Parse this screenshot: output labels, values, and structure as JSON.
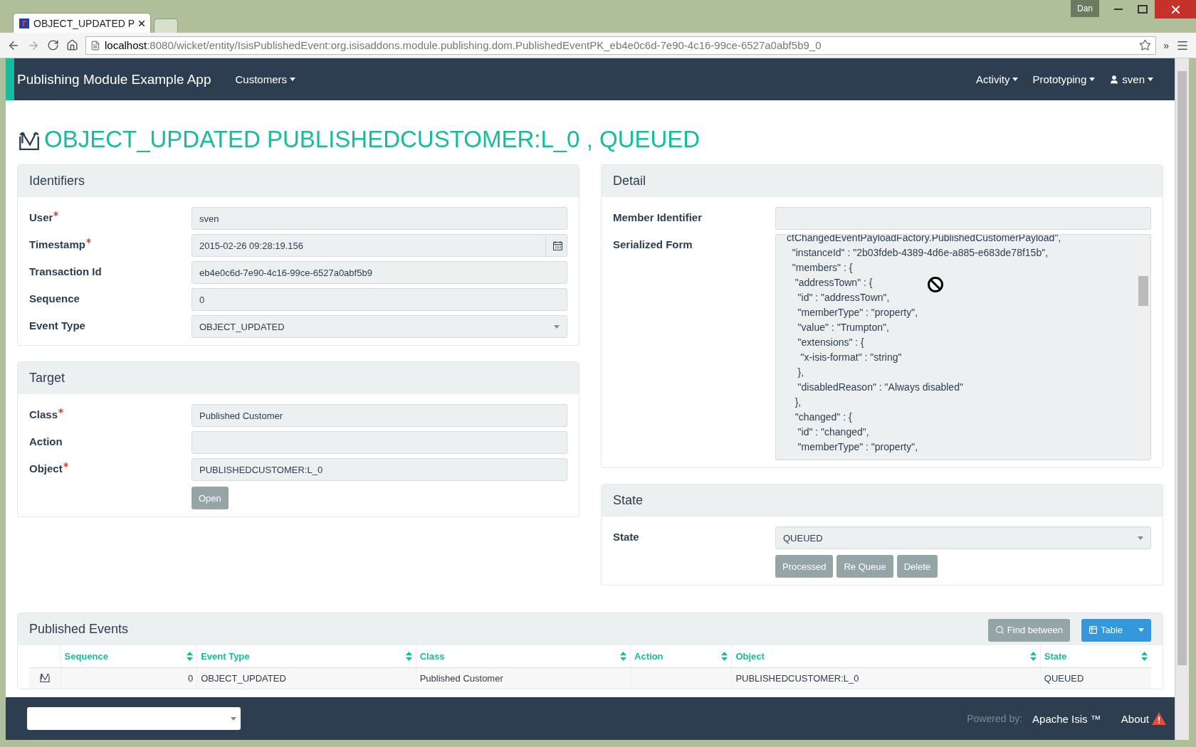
{
  "browser": {
    "tabs": [
      {
        "title": "OBJECT_UPDATED P",
        "selected": true
      },
      {
        "selected": false
      }
    ],
    "user_badge": "Dan",
    "url_host": "localhost",
    "url_path": ":8080/wicket/entity/IsisPublishedEvent:org.isisaddons.module.publishing.dom.PublishedEventPK_eb4e0c6d-7e90-4c16-99ce-6527a0abf5b9_0",
    "overflow": "»"
  },
  "navbar": {
    "brand": "Publishing Module Example App",
    "left_menus": [
      {
        "label": "Customers",
        "kind": "menu"
      }
    ],
    "right_menus": [
      {
        "label": "Activity",
        "kind": "menu"
      },
      {
        "label": "Prototyping",
        "kind": "menu"
      },
      {
        "label": "sven",
        "kind": "user"
      }
    ]
  },
  "title": "OBJECT_UPDATED PUBLISHEDCUSTOMER:L_0 , QUEUED",
  "identifiers": {
    "heading": "Identifiers",
    "fields": [
      {
        "label": "User",
        "required": true,
        "kind": "text",
        "value": "sven"
      },
      {
        "label": "Timestamp",
        "required": true,
        "kind": "date",
        "value": "2015-02-26 09:28:19.156"
      },
      {
        "label": "Transaction Id",
        "required": false,
        "kind": "text",
        "value": "eb4e0c6d-7e90-4c16-99ce-6527a0abf5b9"
      },
      {
        "label": "Sequence",
        "required": false,
        "kind": "text",
        "value": "0"
      },
      {
        "label": "Event Type",
        "required": false,
        "kind": "select",
        "value": "OBJECT_UPDATED"
      }
    ]
  },
  "target": {
    "heading": "Target",
    "fields": [
      {
        "label": "Class",
        "required": true,
        "kind": "text",
        "value": "Published Customer"
      },
      {
        "label": "Action",
        "required": false,
        "kind": "text"
      },
      {
        "label": "Object",
        "required": true,
        "kind": "text",
        "value": "PUBLISHEDCUSTOMER:L_0"
      }
    ],
    "button": "Open"
  },
  "detail": {
    "heading": "Detail",
    "member_identifier_label": "Member Identifier",
    "serialized_form_label": "Serialized Form",
    "serialized_form": [
      "ctChangedEventPayloadFactory.PublishedCustomerPayload\",",
      "  \"instanceId\" : \"2b03fdeb-4389-4d6e-a885-e683de78f15b\",",
      "  \"members\" : {",
      "   \"addressTown\" : {",
      "    \"id\" : \"addressTown\",",
      "    \"memberType\" : \"property\",",
      "    \"value\" : \"Trumpton\",",
      "    \"extensions\" : {",
      "     \"x-isis-format\" : \"string\"",
      "    },",
      "    \"disabledReason\" : \"Always disabled\"",
      "   },",
      "   \"changed\" : {",
      "    \"id\" : \"changed\",",
      "    \"memberType\" : \"property\","
    ]
  },
  "state": {
    "heading": "State",
    "label": "State",
    "value": "QUEUED",
    "buttons": [
      "Processed",
      "Re Queue",
      "Delete"
    ]
  },
  "published_events": {
    "heading": "Published Events",
    "find_button": "Find between",
    "view_button": "Table",
    "columns": [
      "Sequence",
      "Event Type",
      "Class",
      "Action",
      "Object",
      "State"
    ],
    "rows": [
      [
        "0",
        "OBJECT_UPDATED",
        "Published Customer",
        "",
        "PUBLISHEDCUSTOMER:L_0",
        "QUEUED"
      ]
    ]
  },
  "footer": {
    "powered_by": "Powered by:",
    "framework": "Apache Isis ™",
    "about": "About"
  }
}
